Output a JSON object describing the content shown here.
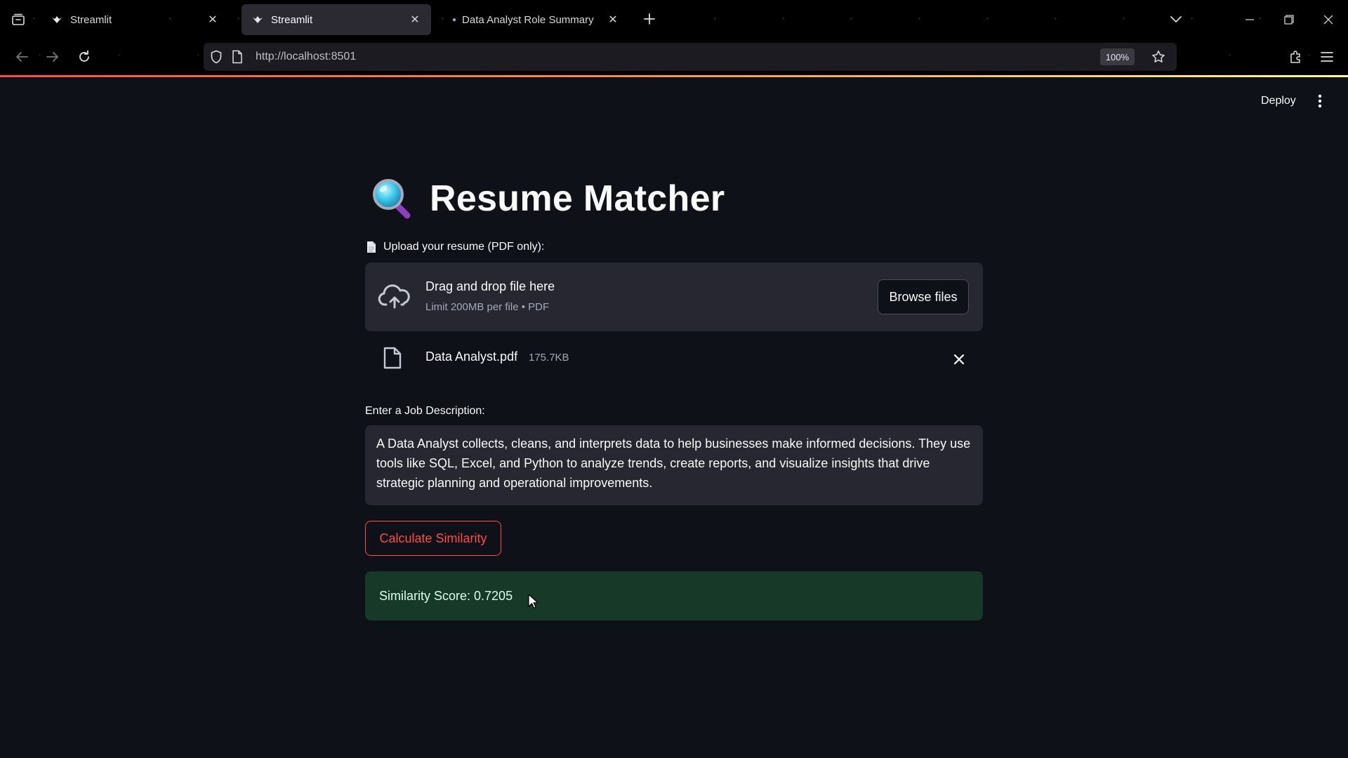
{
  "browser": {
    "tabs": [
      {
        "title": "Streamlit",
        "active": false
      },
      {
        "title": "Streamlit",
        "active": true
      },
      {
        "title": "Data Analyst Role Summary",
        "active": false
      }
    ],
    "url": "http://localhost:8501",
    "zoom": "100%"
  },
  "app_header": {
    "deploy_label": "Deploy"
  },
  "main": {
    "title": "Resume Matcher",
    "title_icon": "magnifying-glass-icon",
    "uploader": {
      "label": "Upload your resume (PDF only):",
      "drop_text": "Drag and drop file here",
      "limit_text": "Limit 200MB per file • PDF",
      "browse_label": "Browse files"
    },
    "uploaded_file": {
      "name": "Data Analyst.pdf",
      "size": "175.7KB"
    },
    "job_description": {
      "label": "Enter a Job Description:",
      "value": "A Data Analyst collects, cleans, and interprets data to help businesses make informed decisions. They use tools like SQL, Excel, and Python to analyze trends, create reports, and visualize insights that drive strategic planning and operational improvements."
    },
    "calculate_label": "Calculate Similarity",
    "result": "Similarity Score: 0.7205"
  },
  "colors": {
    "background": "#0e1117",
    "primary": "#ff4b4b",
    "success_bg": "#173928",
    "widget_bg": "#262730"
  }
}
